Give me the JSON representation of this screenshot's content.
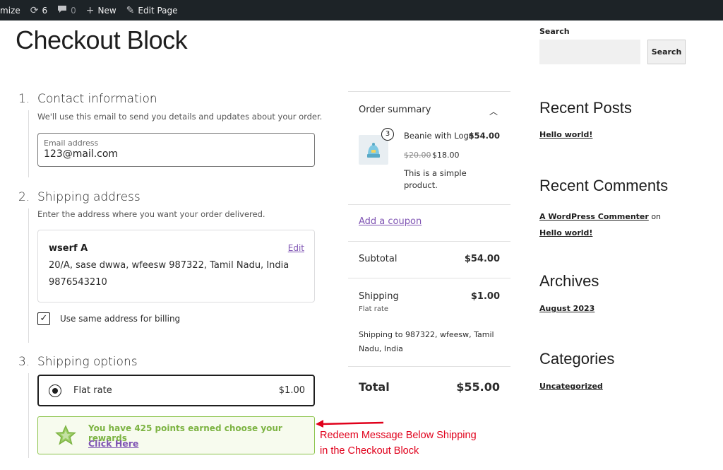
{
  "adminbar": {
    "customize": "mize",
    "updates_count": "6",
    "comments_count": "0",
    "new_label": "New",
    "edit_page_label": "Edit Page"
  },
  "page": {
    "title": "Checkout Block"
  },
  "contact": {
    "number": "1.",
    "title": "Contact information",
    "description": "We'll use this email to send you details and updates about your order.",
    "email_label": "Email address",
    "email_value": "123@mail.com"
  },
  "shipping_address": {
    "number": "2.",
    "title": "Shipping address",
    "description": "Enter the address where you want your order delivered.",
    "name": "wserf A",
    "edit_label": "Edit",
    "address_line": "20/A, sase dwwa, wfeesw 987322, Tamil Nadu, India",
    "phone": "9876543210",
    "billing_checkbox_label": "Use same address for billing",
    "billing_checked": true
  },
  "shipping_options": {
    "number": "3.",
    "title": "Shipping options",
    "rate_name": "Flat rate",
    "rate_price": "$1.00"
  },
  "reward": {
    "message": "You have 425 points earned choose your rewards",
    "link": "Click Here",
    "accent_color": "#7cb342"
  },
  "annotation": {
    "line1": "Redeem Message Below Shipping",
    "line2": "in the Checkout Block",
    "color": "#e0001b"
  },
  "order_summary": {
    "heading": "Order summary",
    "item": {
      "quantity": "3",
      "name": "Beanie with Logo",
      "total": "$54.00",
      "regular_price": "$20.00",
      "sale_price": "$18.00",
      "description": "This is a simple product."
    },
    "coupon_label": "Add a coupon",
    "subtotal_label": "Subtotal",
    "subtotal_value": "$54.00",
    "shipping_label": "Shipping",
    "shipping_value": "$1.00",
    "shipping_method": "Flat rate",
    "shipping_to": "Shipping to 987322, wfeesw, Tamil Nadu, India",
    "total_label": "Total",
    "total_value": "$55.00"
  },
  "sidebar": {
    "search_label": "Search",
    "search_button": "Search",
    "recent_posts_title": "Recent Posts",
    "recent_post": "Hello world!",
    "recent_comments_title": "Recent Comments",
    "comment_author": "A WordPress Commenter",
    "comment_on": "on",
    "comment_post": "Hello world!",
    "archives_title": "Archives",
    "archive_item": "August 2023",
    "categories_title": "Categories",
    "category_item": "Uncategorized"
  },
  "colors": {
    "link": "#7f54b3",
    "adminbar": "#1d2327"
  }
}
